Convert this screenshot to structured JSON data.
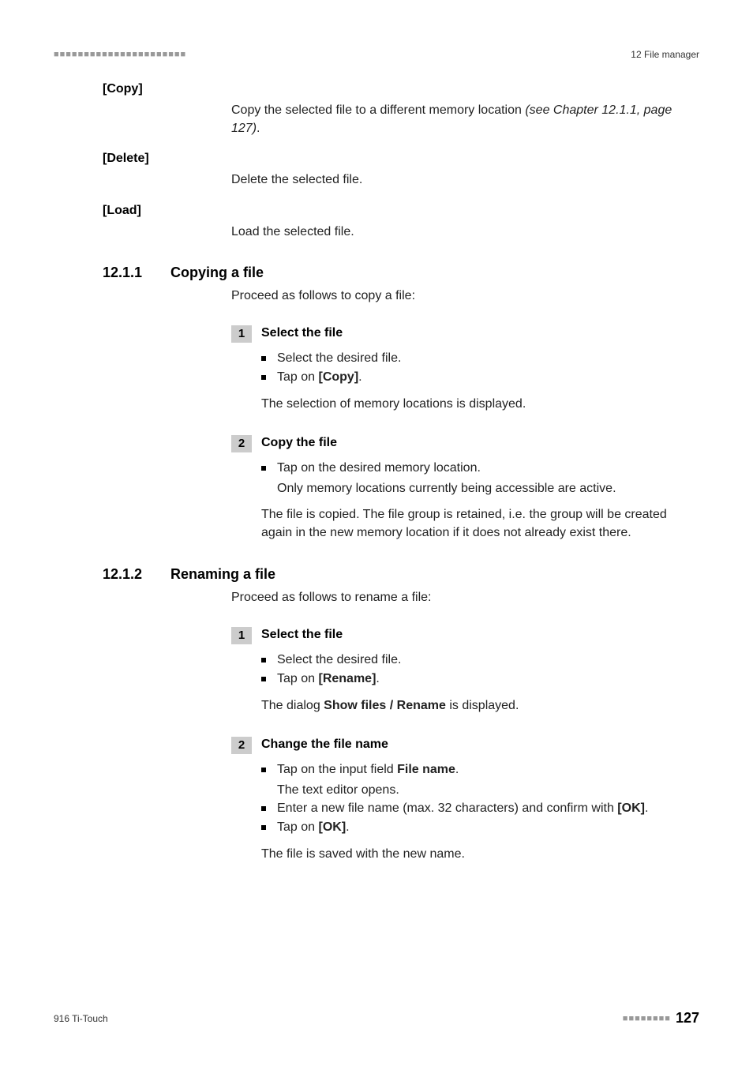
{
  "header": {
    "dashes": "■■■■■■■■■■■■■■■■■■■■■■",
    "chapter": "12 File manager"
  },
  "defs": {
    "copy": {
      "term": "[Copy]",
      "body_pre": "Copy the selected file to a different memory location ",
      "body_italic": "(see Chapter 12.1.1, page 127)",
      "body_post": "."
    },
    "delete": {
      "term": "[Delete]",
      "body": "Delete the selected file."
    },
    "load": {
      "term": "[Load]",
      "body": "Load the selected file."
    }
  },
  "sec1": {
    "num": "12.1.1",
    "title": "Copying a file",
    "intro": "Proceed as follows to copy a file:",
    "step1": {
      "num": "1",
      "title": "Select the file",
      "b1": "Select the desired file.",
      "b2_pre": "Tap on ",
      "b2_bold": "[Copy]",
      "b2_post": ".",
      "result": "The selection of memory locations is displayed."
    },
    "step2": {
      "num": "2",
      "title": "Copy the file",
      "b1": "Tap on the desired memory location.",
      "b1_sub": "Only memory locations currently being accessible are active.",
      "result": "The file is copied. The file group is retained, i.e. the group will be created again in the new memory location if it does not already exist there."
    }
  },
  "sec2": {
    "num": "12.1.2",
    "title": "Renaming a file",
    "intro": "Proceed as follows to rename a file:",
    "step1": {
      "num": "1",
      "title": "Select the file",
      "b1": "Select the desired file.",
      "b2_pre": "Tap on ",
      "b2_bold": "[Rename]",
      "b2_post": ".",
      "result_pre": "The dialog ",
      "result_bold": "Show files / Rename",
      "result_post": " is displayed."
    },
    "step2": {
      "num": "2",
      "title": "Change the file name",
      "b1_pre": "Tap on the input field ",
      "b1_bold": "File name",
      "b1_post": ".",
      "b1_sub": "The text editor opens.",
      "b2_pre": "Enter a new file name (max. 32 characters) and confirm with ",
      "b2_bold": "[OK]",
      "b2_post": ".",
      "b3_pre": "Tap on ",
      "b3_bold": "[OK]",
      "b3_post": ".",
      "result": "The file is saved with the new name."
    }
  },
  "footer": {
    "left": "916 Ti-Touch",
    "dashes": "■■■■■■■■",
    "page": "127"
  }
}
